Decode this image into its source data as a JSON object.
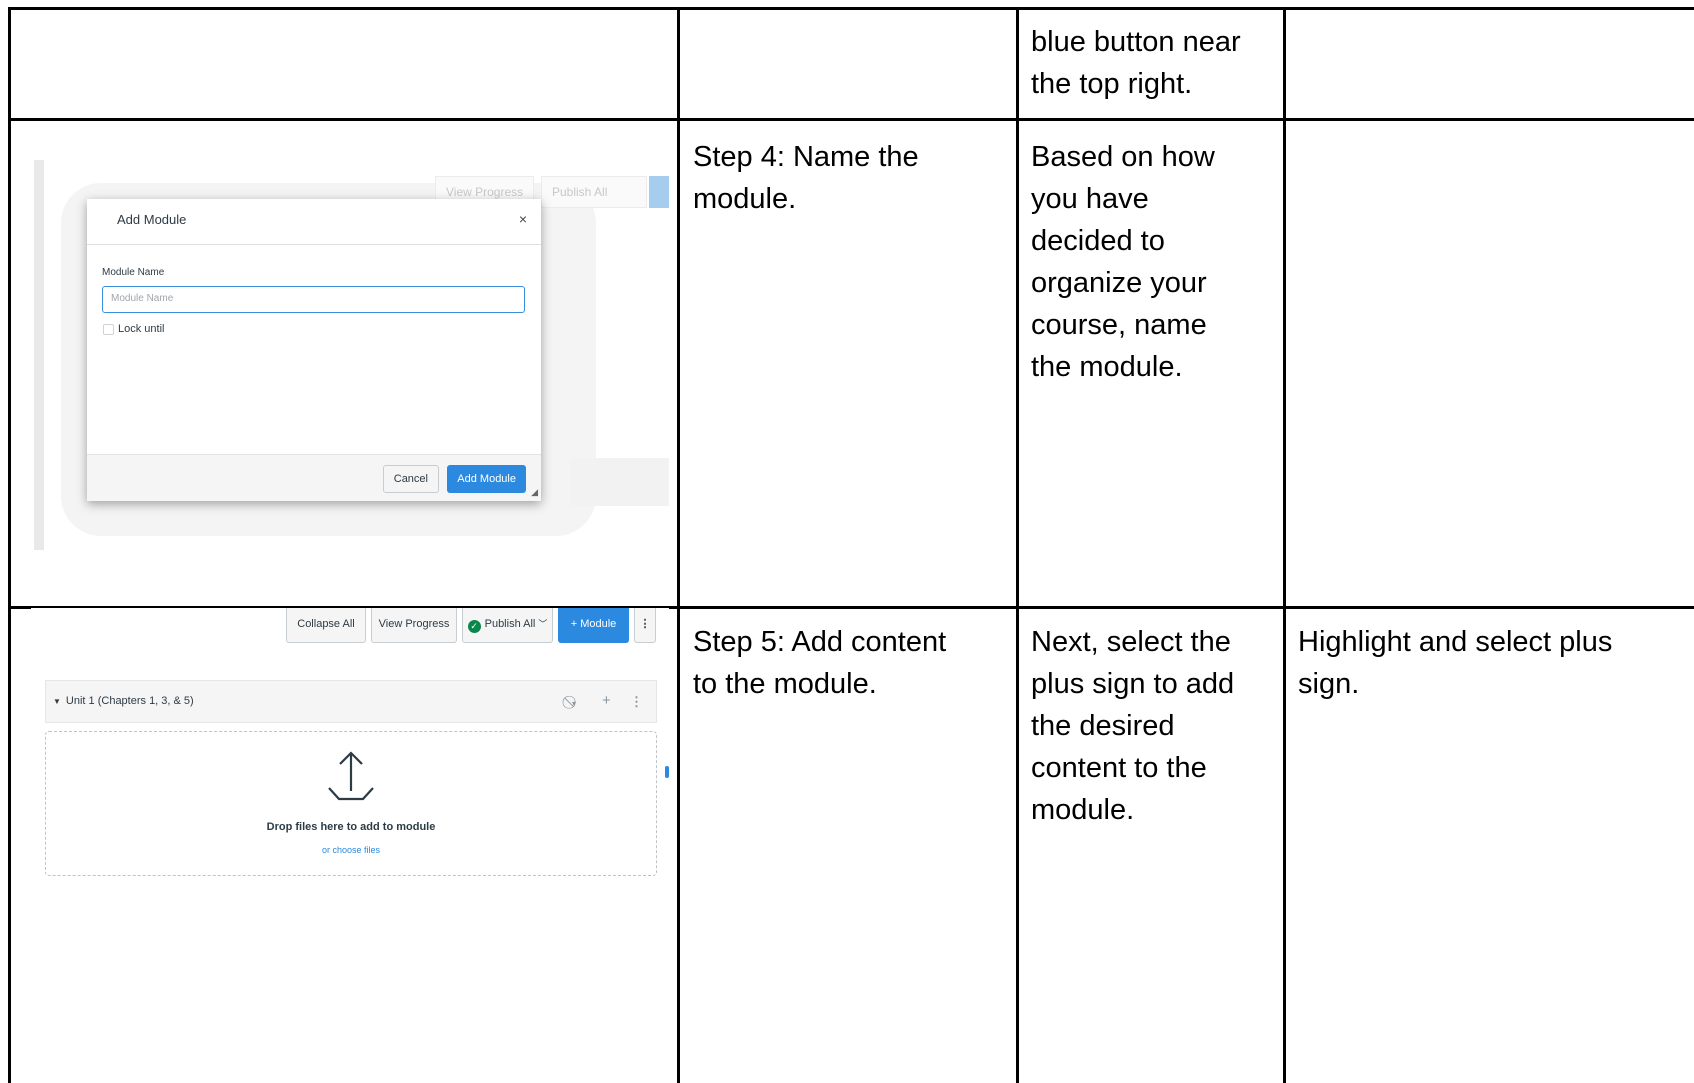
{
  "table": {
    "row1": {
      "col3": "blue button near\nthe top right.",
      "col4": ""
    },
    "row2": {
      "step": " Step 4: Name the\nmodule.",
      "description": "Based on how\nyou have\ndecided to\norganize your\ncourse, name\nthe module.",
      "accessibility": ""
    },
    "row3": {
      "step": "Step 5: Add content\nto the module.",
      "description": "Next, select the\nplus sign to add\nthe desired\ncontent to the\nmodule.",
      "accessibility": "Highlight and select plus\nsign."
    }
  },
  "screenshot_add_module": {
    "background_buttons": [
      "View Progress",
      "Publish All"
    ],
    "dialog_title": "Add Module",
    "close_glyph": "×",
    "field_label": "Module Name",
    "field_placeholder": "Module Name",
    "lock_label": "Lock until",
    "cancel_label": "Cancel",
    "add_label": "Add Module"
  },
  "screenshot_modules": {
    "toolbar": {
      "collapse_all": "Collapse All",
      "view_progress": "View Progress",
      "publish_all": "Publish All",
      "add_module": "+ Module"
    },
    "unit_title": "Unit 1 (Chapters 1, 3, & 5)",
    "drop_text": "Drop files here to add to module",
    "choose_files": "or choose files"
  },
  "colors": {
    "canvas_blue": "#2b8ae0",
    "published_green": "#0b874b",
    "grid_line": "#000000"
  }
}
